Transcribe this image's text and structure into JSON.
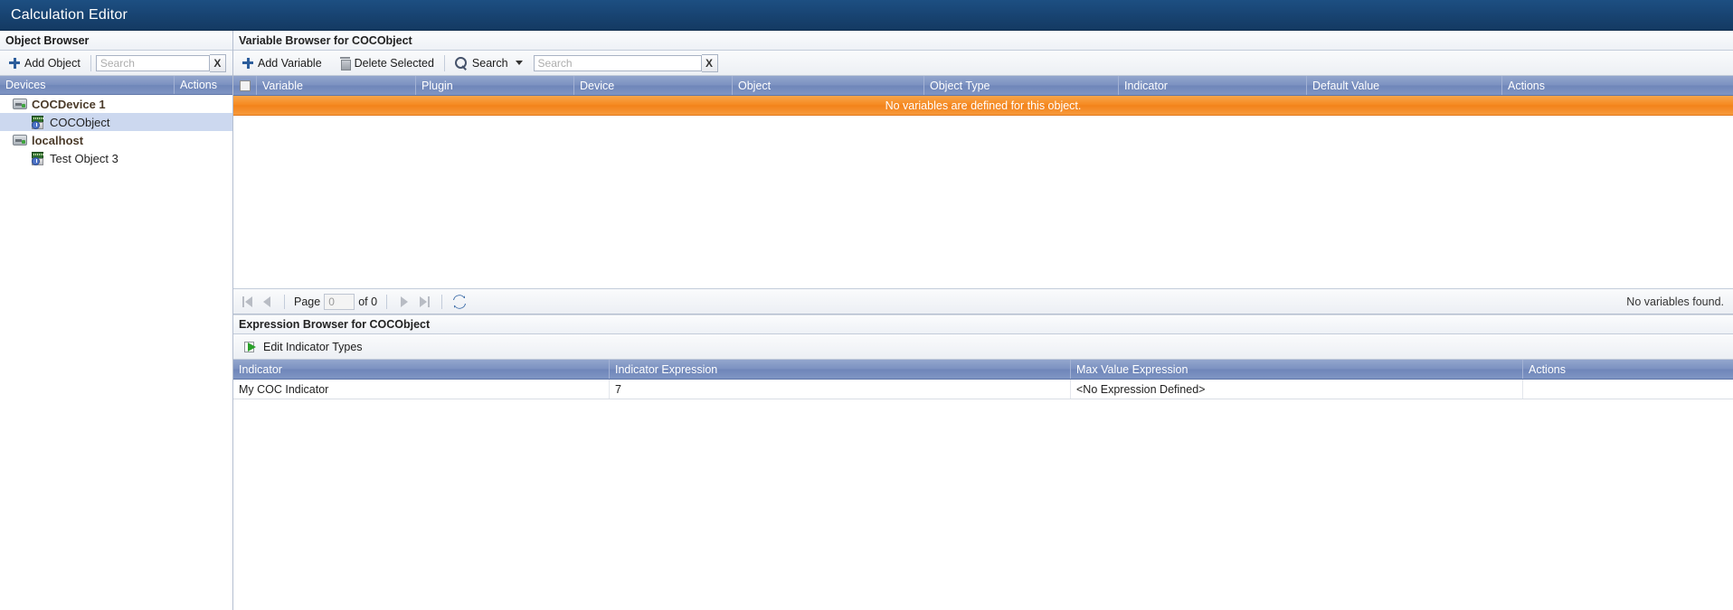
{
  "window": {
    "title": "Calculation Editor"
  },
  "object_browser": {
    "header": "Object Browser",
    "add_object_label": "Add Object",
    "search_placeholder": "Search",
    "search_value": "",
    "clear_label": "X",
    "columns": [
      "Devices",
      "Actions"
    ],
    "tree": [
      {
        "label": "COCDevice 1",
        "type": "device",
        "level": 1,
        "selected": false
      },
      {
        "label": "COCObject",
        "type": "object",
        "level": 2,
        "selected": true
      },
      {
        "label": "localhost",
        "type": "device",
        "level": 1,
        "selected": false
      },
      {
        "label": "Test Object 3",
        "type": "object",
        "level": 2,
        "selected": false
      }
    ]
  },
  "variable_browser": {
    "header": "Variable Browser for COCObject",
    "toolbar": {
      "add_variable_label": "Add Variable",
      "delete_selected_label": "Delete Selected",
      "search_label": "Search",
      "search_placeholder": "Search",
      "search_value": "",
      "clear_label": "X"
    },
    "columns": [
      "Variable",
      "Plugin",
      "Device",
      "Object",
      "Object Type",
      "Indicator",
      "Default Value",
      "Actions"
    ],
    "empty_message": "No variables are defined for this object.",
    "rows": [],
    "pager": {
      "page_label": "Page",
      "page_value": "0",
      "of_label": "of 0",
      "status": "No variables found."
    }
  },
  "expression_browser": {
    "header": "Expression Browser for COCObject",
    "edit_indicator_types_label": "Edit Indicator Types",
    "columns": [
      "Indicator",
      "Indicator Expression",
      "Max Value Expression",
      "Actions"
    ],
    "rows": [
      {
        "indicator": "My COC Indicator",
        "indicator_expression": "7",
        "max_value_expression": "<No Expression Defined>",
        "actions": ""
      }
    ]
  },
  "colors": {
    "titlebar": "#184472",
    "grid_header": "#7c92c1",
    "warning_banner": "#f5881f",
    "selection": "#ccd8ef"
  }
}
